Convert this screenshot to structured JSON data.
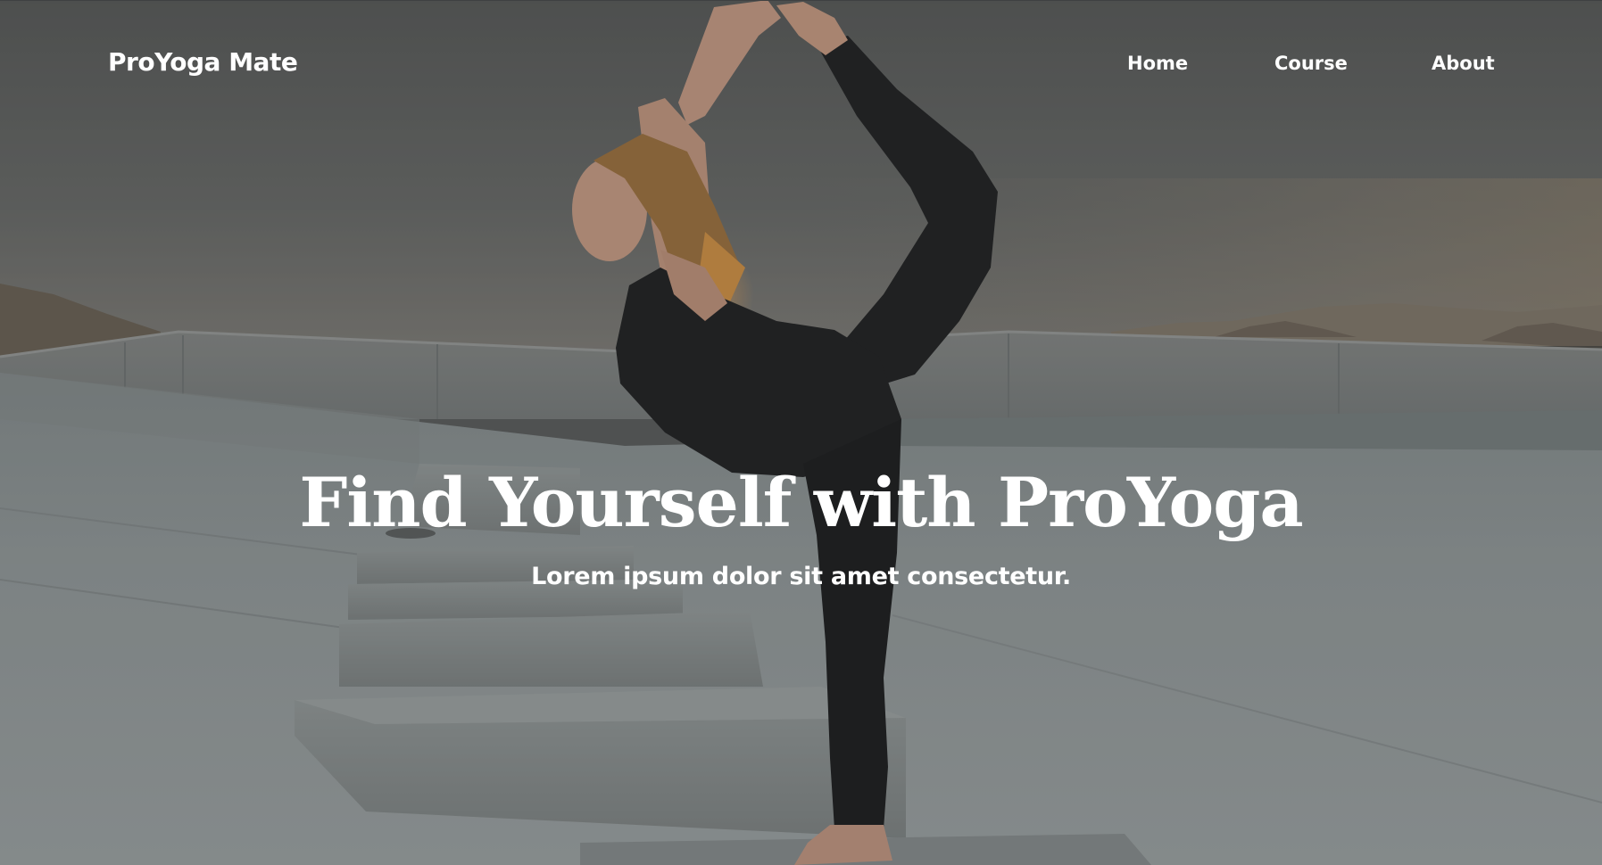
{
  "header": {
    "brand": "ProYoga Mate",
    "nav": [
      {
        "label": "Home"
      },
      {
        "label": "Course"
      },
      {
        "label": "About"
      }
    ]
  },
  "hero": {
    "title": "Find Yourself with ProYoga",
    "subtitle": "Lorem ipsum dolor sit amet consectetur.",
    "background": "yoga-pose-photo"
  },
  "colors": {
    "text": "#ffffff",
    "overlay": "#5d5f5f"
  }
}
